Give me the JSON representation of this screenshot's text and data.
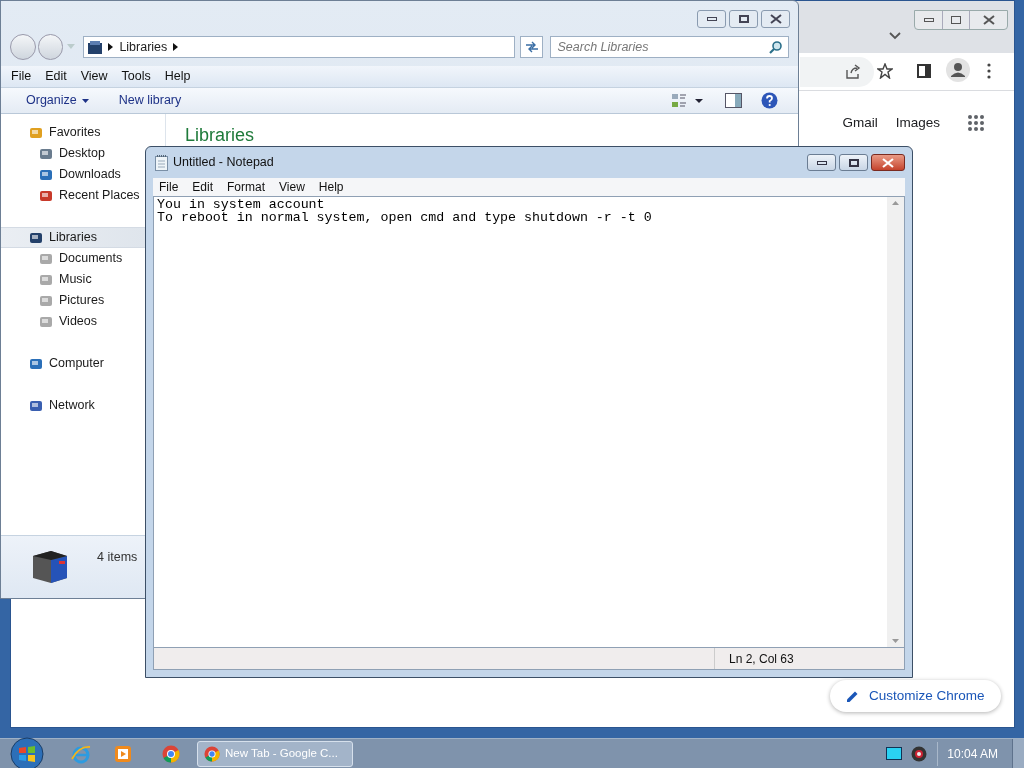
{
  "chrome": {
    "links": [
      "Gmail",
      "Images"
    ],
    "customize_button": "Customize Chrome"
  },
  "explorer": {
    "address_path": [
      "Libraries"
    ],
    "search_placeholder": "Search Libraries",
    "menu": [
      "File",
      "Edit",
      "View",
      "Tools",
      "Help"
    ],
    "toolbar": [
      "Organize",
      "New library"
    ],
    "nav": [
      {
        "label": "Favorites",
        "selected": false,
        "children": [
          {
            "label": "Desktop",
            "selected": false
          },
          {
            "label": "Downloads",
            "selected": false
          },
          {
            "label": "Recent Places",
            "selected": false
          }
        ]
      },
      {
        "label": "Libraries",
        "selected": true,
        "children": [
          {
            "label": "Documents",
            "selected": false
          },
          {
            "label": "Music",
            "selected": false
          },
          {
            "label": "Pictures",
            "selected": false
          },
          {
            "label": "Videos",
            "selected": false
          }
        ]
      },
      {
        "label": "Computer",
        "selected": false
      },
      {
        "label": "Network",
        "selected": false
      }
    ],
    "heading": "Libraries",
    "status": "4 items"
  },
  "notepad": {
    "title": "Untitled - Notepad",
    "menu": [
      "File",
      "Edit",
      "Format",
      "View",
      "Help"
    ],
    "lines": [
      "You in system account",
      "To reboot in normal system, open cmd and type shutdown -r -t 0"
    ],
    "status": "Ln 2, Col 63"
  },
  "taskbar": {
    "windows": [
      {
        "label": "New Tab - Google C...",
        "selected": true
      }
    ],
    "clock": "10:04 AM"
  }
}
